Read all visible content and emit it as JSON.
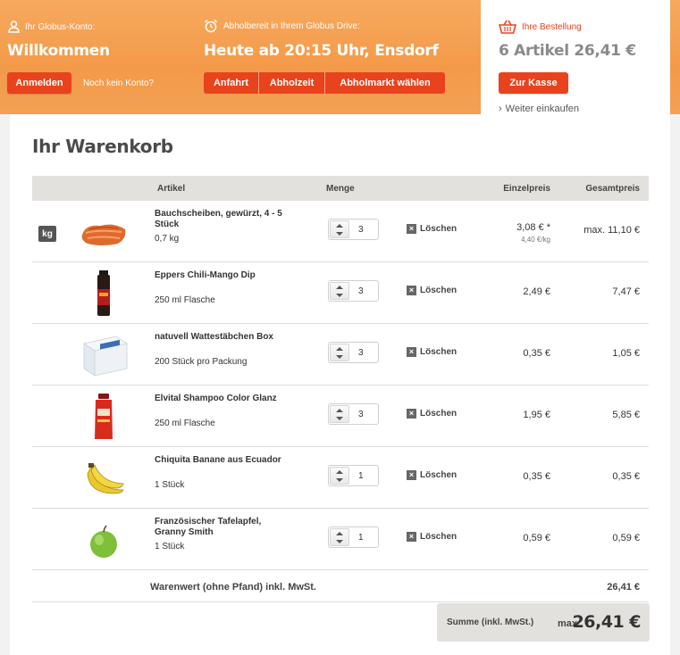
{
  "header": {
    "account_label": "Ihr Globus-Konto:",
    "welcome": "Willkommen",
    "login_button": "Anmelden",
    "no_account_link": "Noch kein Konto?",
    "pickup_label": "Abholbereit in Ihrem Globus Drive:",
    "pickup_time": "Heute ab 20:15 Uhr, Ensdorf",
    "pickup_buttons": [
      "Anfahrt",
      "Abholzeit",
      "Abholmarkt wählen"
    ],
    "order_label": "Ihre Bestellung",
    "order_summary": "6 Artikel 26,41 €",
    "checkout_button": "Zur Kasse",
    "continue_link": "Weiter einkaufen"
  },
  "cart": {
    "title": "Ihr Warenkorb",
    "columns": {
      "article": "Artikel",
      "quantity": "Menge",
      "unit_price": "Einzelpreis",
      "total_price": "Gesamtpreis"
    },
    "delete_label": "Löschen",
    "items": [
      {
        "name": "Bauchscheiben, gewürzt, 4 - 5 Stück",
        "unit": "0,7 kg",
        "qty": "3",
        "unit_price": "3,08 € *",
        "unit_price_sub": "4,40 €/kg",
        "total": "max. 11,10 €",
        "badge": "kg",
        "image": "pork-belly"
      },
      {
        "name": "Eppers Chili-Mango Dip",
        "unit": "250 ml Flasche",
        "qty": "3",
        "unit_price": "2,49 €",
        "total": "7,47 €",
        "image": "dip-bottle"
      },
      {
        "name": "natuvell Wattestäbchen Box",
        "unit": "200 Stück pro Packung",
        "qty": "3",
        "unit_price": "0,35 €",
        "total": "1,05 €",
        "image": "cotton-swab-box"
      },
      {
        "name": "Elvital Shampoo Color Glanz",
        "unit": "250 ml Flasche",
        "qty": "3",
        "unit_price": "1,95 €",
        "total": "5,85 €",
        "image": "shampoo-bottle"
      },
      {
        "name": "Chiquita Banane aus Ecuador",
        "unit": "1 Stück",
        "qty": "1",
        "unit_price": "0,35 €",
        "total": "0,35 €",
        "image": "bananas"
      },
      {
        "name": "Französischer Tafelapfel, Granny Smith",
        "unit": "1 Stück",
        "qty": "1",
        "unit_price": "0,59 €",
        "total": "0,59 €",
        "image": "green-apple"
      }
    ],
    "subtotal_label": "Warenwert (ohne Pfand) inkl. MwSt.",
    "subtotal_value": "26,41 €",
    "grand_label": "Summe (inkl. MwSt.)",
    "grand_prefix": "max.",
    "grand_value": "26,41 €"
  },
  "colors": {
    "header_orange": "#f39a49",
    "button_red": "#e8431d",
    "cart_icon": "#e8431d"
  }
}
